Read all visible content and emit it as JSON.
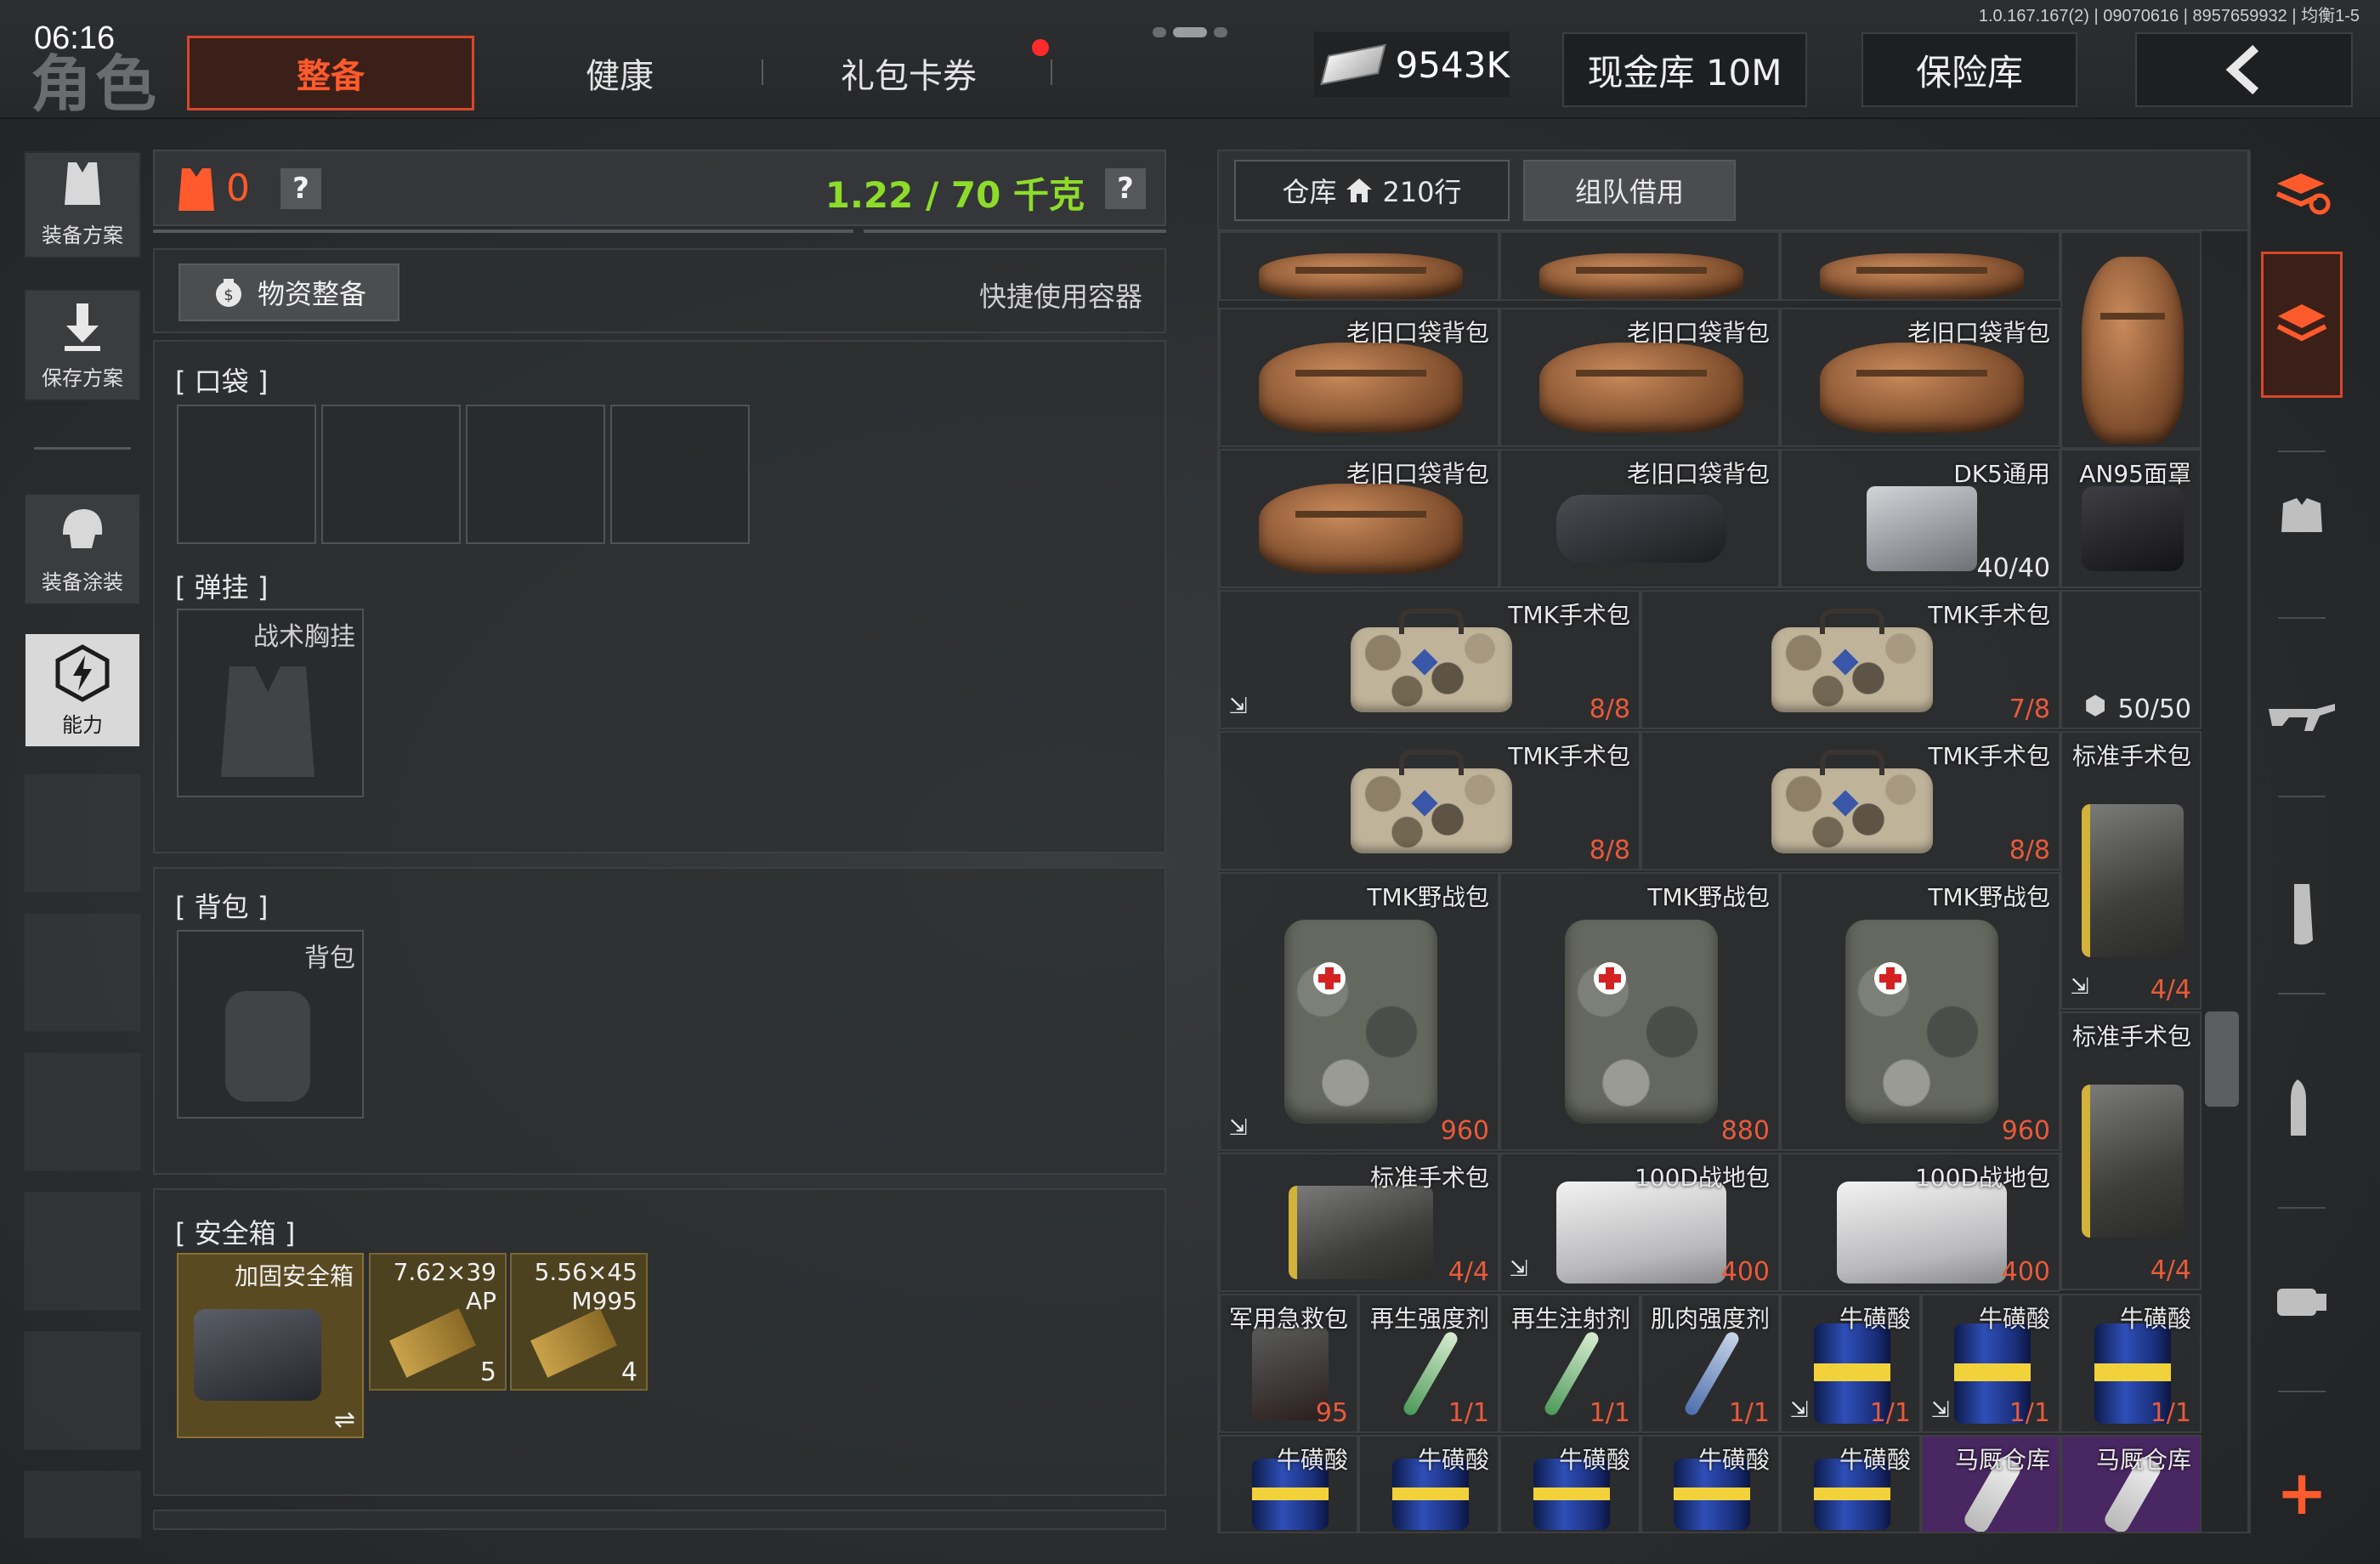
{
  "status": {
    "clock": "06:16",
    "build": "1.0.167.167(2) | 09070616 | 8957659932 | 均衡1-5"
  },
  "header": {
    "title": "角色",
    "tabs": [
      {
        "label": "整备"
      },
      {
        "label": "健康"
      },
      {
        "label": "礼包卡券"
      }
    ],
    "money": "9543K",
    "cash_vault": "现金库 10M",
    "safe_vault": "保险库"
  },
  "sidebar": {
    "items": [
      {
        "label": "装备方案"
      },
      {
        "label": "保存方案"
      },
      {
        "label": "装备涂装"
      },
      {
        "label": "能力"
      }
    ]
  },
  "loadout": {
    "armor_count": "0",
    "help": "?",
    "weight": "1.22 / 70 千克",
    "supply_button": "物资整备",
    "quick_container": "快捷使用容器",
    "pocket_label": "[ 口袋 ]",
    "rig_label": "[ 弹挂 ]",
    "rig_placeholder": "战术胸挂",
    "backpack_label": "[ 背包 ]",
    "backpack_placeholder": "背包",
    "safebox_label": "[ 安全箱 ]",
    "safebox_items": [
      {
        "name": "加固安全箱",
        "count": "⇌"
      },
      {
        "name": "7.62×39",
        "sub": "AP",
        "count": "5"
      },
      {
        "name": "5.56×45",
        "sub": "M995",
        "count": "4"
      }
    ]
  },
  "warehouse": {
    "tab_storage": "仓库",
    "rows_count": "210行",
    "tab_team": "组队借用",
    "items": [
      {
        "name": "",
        "count": ""
      },
      {
        "name": "",
        "count": ""
      },
      {
        "name": "",
        "count": ""
      },
      {
        "name": "",
        "count": ""
      },
      {
        "name": "老旧口袋背包",
        "count": ""
      },
      {
        "name": "老旧口袋背包",
        "count": ""
      },
      {
        "name": "老旧口袋背包",
        "count": ""
      },
      {
        "name": "老旧口袋背包",
        "count": ""
      },
      {
        "name": "老旧口袋背包",
        "count": ""
      },
      {
        "name": "DK5通用",
        "count": "40/40"
      },
      {
        "name": "AN95面罩",
        "count": ""
      },
      {
        "name": "TMK手术包",
        "count": "8/8"
      },
      {
        "name": "TMK手术包",
        "count": "7/8"
      },
      {
        "name": "",
        "count": "50/50"
      },
      {
        "name": "TMK手术包",
        "count": "8/8"
      },
      {
        "name": "TMK手术包",
        "count": "8/8"
      },
      {
        "name": "标准手术包",
        "count": "4/4"
      },
      {
        "name": "TMK野战包",
        "count": "960"
      },
      {
        "name": "TMK野战包",
        "count": "880"
      },
      {
        "name": "TMK野战包",
        "count": "960"
      },
      {
        "name": "标准手术包",
        "count": "4/4"
      },
      {
        "name": "标准手术包",
        "count": "4/4"
      },
      {
        "name": "100D战地包",
        "count": "400"
      },
      {
        "name": "100D战地包",
        "count": "400"
      },
      {
        "name": "军用急救包",
        "count": "95"
      },
      {
        "name": "再生强度剂",
        "count": "1/1"
      },
      {
        "name": "再生注射剂",
        "count": "1/1"
      },
      {
        "name": "肌肉强度剂",
        "count": "1/1"
      },
      {
        "name": "牛磺酸",
        "count": "1/1"
      },
      {
        "name": "牛磺酸",
        "count": "1/1"
      },
      {
        "name": "牛磺酸",
        "count": "1/1"
      },
      {
        "name": "牛磺酸",
        "count": ""
      },
      {
        "name": "牛磺酸",
        "count": ""
      },
      {
        "name": "牛磺酸",
        "count": ""
      },
      {
        "name": "牛磺酸",
        "count": ""
      },
      {
        "name": "牛磺酸",
        "count": ""
      },
      {
        "name": "马厩仓库",
        "count": ""
      },
      {
        "name": "马厩仓库",
        "count": ""
      }
    ],
    "move_icon": "⇲"
  },
  "right_rail": {
    "add": "+"
  },
  "colors": {
    "accent": "#ff5a2c",
    "weight_ok": "#8ddc2a",
    "count_red": "#e95a3a",
    "vault_purple": "#562876"
  }
}
